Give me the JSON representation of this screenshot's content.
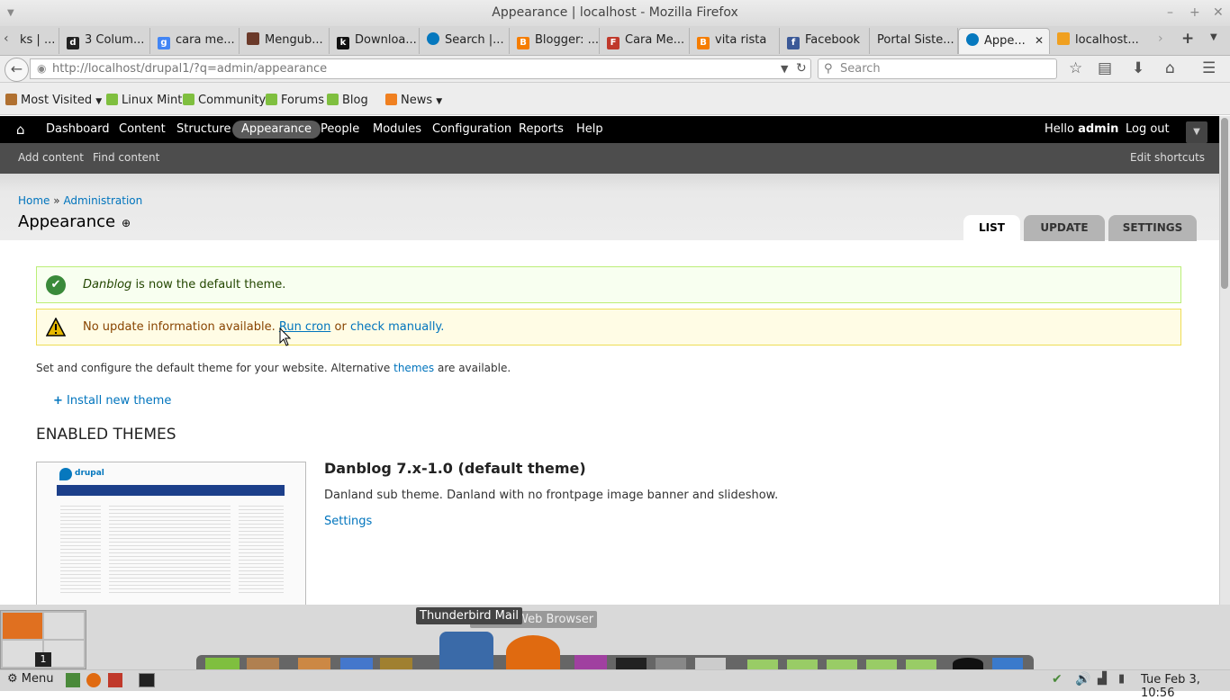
{
  "window": {
    "title": "Appearance | localhost - Mozilla Firefox"
  },
  "tabs": [
    {
      "label": "ks | ...",
      "fav_color": "#777777",
      "fav_char": ""
    },
    {
      "label": "3 Colum...",
      "fav_color": "#222222",
      "fav_char": "d"
    },
    {
      "label": "cara me...",
      "fav_color": "#4285f4",
      "fav_char": "g"
    },
    {
      "label": "Mengub...",
      "fav_color": "#6b3a2a",
      "fav_char": ""
    },
    {
      "label": "Downloa...",
      "fav_color": "#111111",
      "fav_char": "k"
    },
    {
      "label": "Search |...",
      "fav_color": "#0678be",
      "fav_char": ""
    },
    {
      "label": "Blogger: ...",
      "fav_color": "#f57d00",
      "fav_char": "B"
    },
    {
      "label": "Cara Me...",
      "fav_color": "#c0392b",
      "fav_char": "F"
    },
    {
      "label": "vita rista",
      "fav_color": "#f57d00",
      "fav_char": "B"
    },
    {
      "label": "Facebook",
      "fav_color": "#3b5998",
      "fav_char": "f"
    },
    {
      "label": "Portal Siste...",
      "fav_color": "",
      "fav_char": ""
    },
    {
      "label": "Appe...",
      "fav_color": "#0678be",
      "fav_char": ""
    },
    {
      "label": "localhost...",
      "fav_color": "#f0a020",
      "fav_char": ""
    }
  ],
  "nav": {
    "url_host": "http://localhost",
    "url_path": "/drupal1/?q=admin/appearance",
    "search_placeholder": "Search"
  },
  "bookmarks": {
    "most_visited": "Most Visited",
    "linux_mint": "Linux Mint",
    "community": "Community",
    "forums": "Forums",
    "blog": "Blog",
    "news": "News"
  },
  "toolbar": {
    "dashboard": "Dashboard",
    "content": "Content",
    "structure": "Structure",
    "appearance": "Appearance",
    "people": "People",
    "modules": "Modules",
    "configuration": "Configuration",
    "reports": "Reports",
    "help": "Help",
    "hello": "Hello",
    "user": "admin",
    "logout": "Log out"
  },
  "shortcuts": {
    "add_content": "Add content",
    "find_content": "Find content",
    "edit_shortcuts": "Edit shortcuts"
  },
  "breadcrumb": {
    "home": "Home",
    "sep": "»",
    "admin": "Administration"
  },
  "page_title": "Appearance",
  "page_tabs": {
    "list": "LIST",
    "update": "UPDATE",
    "settings": "SETTINGS"
  },
  "messages": {
    "status_theme": "Danblog",
    "status_rest": "is now the default theme.",
    "warning_prefix": "No update information available.",
    "run_cron": "Run cron",
    "or": "or",
    "check_manually": "check manually."
  },
  "intro": {
    "before": "Set and configure the default theme for your website. Alternative",
    "link": "themes",
    "after": "are available."
  },
  "install_link": "Install new theme",
  "enabled_heading": "ENABLED THEMES",
  "theme": {
    "name": "Danblog 7.x-1.0 (default theme)",
    "description": "Danland sub theme. Danland with no frontpage image banner and slideshow.",
    "settings": "Settings",
    "thumb_logo": "drupal"
  },
  "dock": {
    "tooltip_thunderbird": "Thunderbird Mail",
    "tooltip_browser": "Web Browser",
    "workspace_num": "1"
  },
  "panel": {
    "menu": "Menu",
    "clock": "Tue Feb 3, 10:56"
  }
}
